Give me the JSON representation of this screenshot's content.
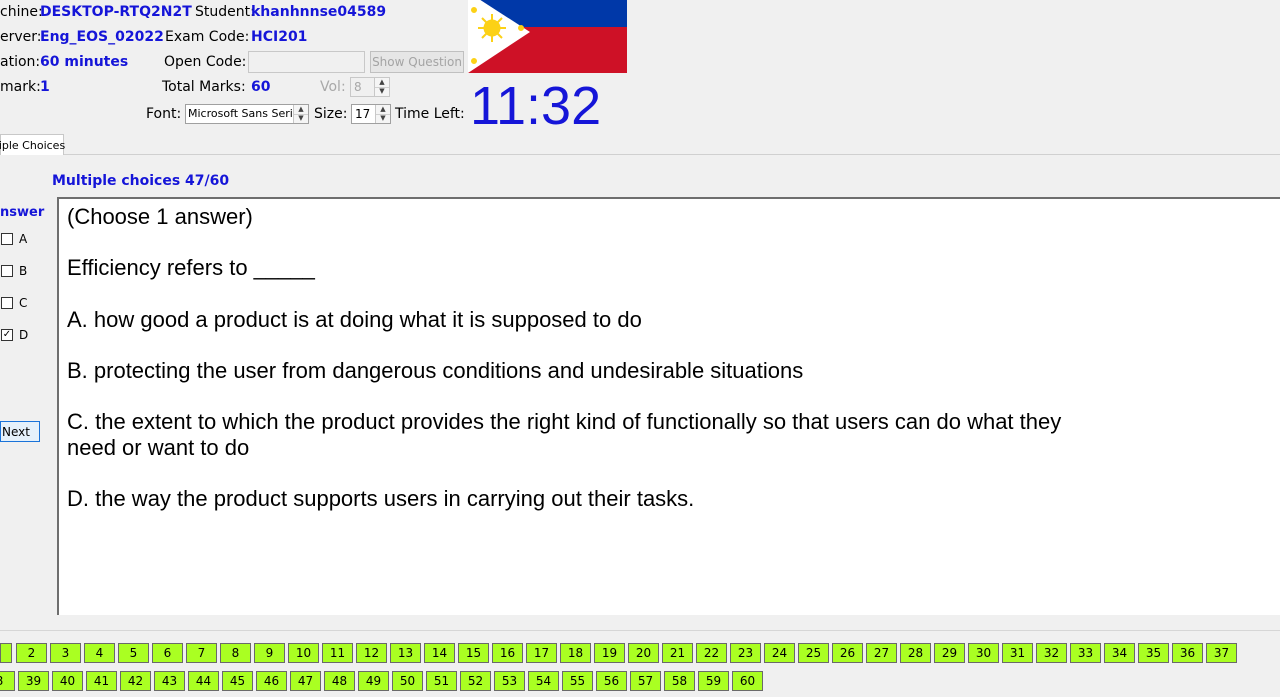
{
  "header": {
    "machine_label": "chine:",
    "machine_value": "DESKTOP-RTQ2N2T",
    "student_label": "Student:",
    "student_value": "khanhnnse04589",
    "server_label": "erver:",
    "server_value": "Eng_EOS_02022",
    "exam_code_label": "Exam Code:",
    "exam_code_value": "HCI201",
    "duration_label": "ation:",
    "duration_value": "60 minutes",
    "open_code_label": "Open Code:",
    "open_code_value": "",
    "show_question_label": "Show Question",
    "mark_label": "mark:",
    "mark_value": "1",
    "total_marks_label": "Total Marks:",
    "total_marks_value": "60",
    "vol_label": "Vol:",
    "vol_value": "8",
    "font_label": "Font:",
    "font_value": "Microsoft Sans Serif",
    "size_label": "Size:",
    "size_value": "17",
    "time_left_label": "Time Left:",
    "time_left_value": "11:32",
    "timer_color": "#1515d8"
  },
  "tabs": [
    {
      "label": "iple Choices"
    }
  ],
  "question": {
    "counter": "Multiple choices 47/60",
    "answer_header": "nswer",
    "options": [
      {
        "label": "A",
        "checked": false
      },
      {
        "label": "B",
        "checked": false
      },
      {
        "label": "C",
        "checked": false
      },
      {
        "label": "D",
        "checked": true
      }
    ],
    "next_label": "Next",
    "instruction": "(Choose 1 answer)",
    "stem": "Efficiency refers to _____",
    "answers": [
      "A.  how good a product is at doing what it is supposed to do",
      "B.  protecting the user from dangerous conditions and undesirable situations",
      "C.  the extent to which the product provides the right kind of functionally so that users can do what they",
      "need or want to do",
      "D.  the way the product supports users in carrying out their tasks."
    ]
  },
  "navigator": {
    "row1": [
      "2",
      "3",
      "4",
      "5",
      "6",
      "7",
      "8",
      "9",
      "10",
      "11",
      "12",
      "13",
      "14",
      "15",
      "16",
      "17",
      "18",
      "19",
      "20",
      "21",
      "22",
      "23",
      "24",
      "25",
      "26",
      "27",
      "28",
      "29",
      "30",
      "31",
      "32",
      "33",
      "34",
      "35",
      "36",
      "37"
    ],
    "row2": [
      "8",
      "39",
      "40",
      "41",
      "42",
      "43",
      "44",
      "45",
      "46",
      "47",
      "48",
      "49",
      "50",
      "51",
      "52",
      "53",
      "54",
      "55",
      "56",
      "57",
      "58",
      "59",
      "60"
    ],
    "answered_color": "#aaff22"
  },
  "flag": {
    "name": "philippines-flag",
    "colors": {
      "blue": "#0038a8",
      "red": "#ce1126",
      "white": "#ffffff",
      "gold": "#fcd116"
    }
  }
}
